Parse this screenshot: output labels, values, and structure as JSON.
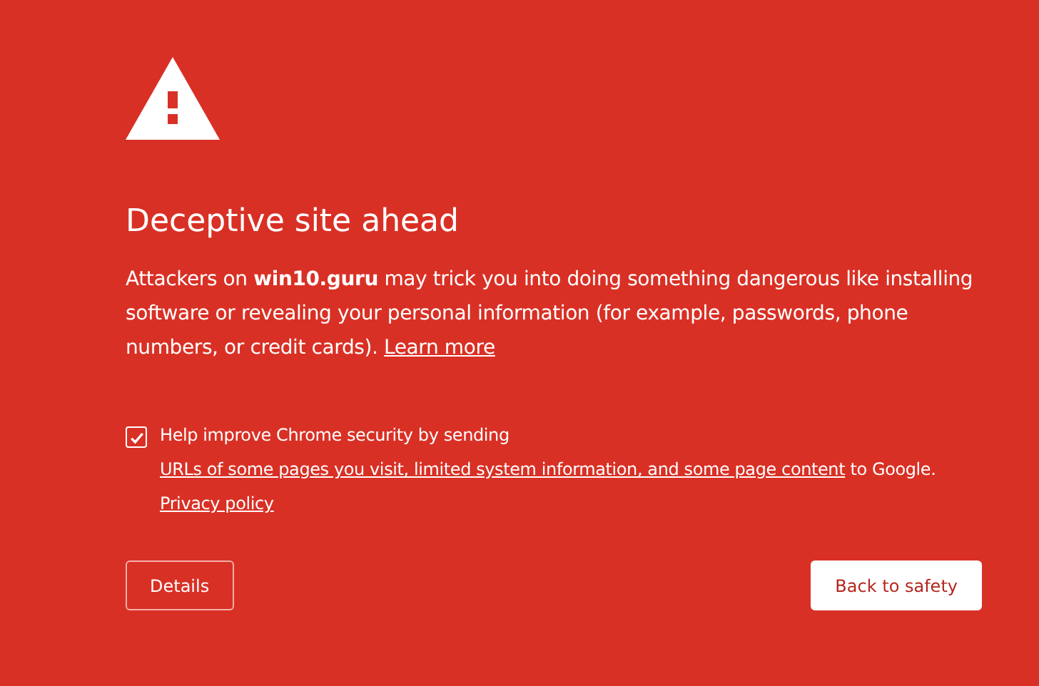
{
  "title": "Deceptive site ahead",
  "message": [
    {
      "kind": "text",
      "text": "Attackers on **win10.guru** may trick you into doing something dangerous like installing software or revealing your personal information (for example, passwords, phone numbers, or credit cards). "
    },
    {
      "kind": "link",
      "text": "Learn more"
    }
  ],
  "report": {
    "checked": true,
    "parts": [
      {
        "kind": "text",
        "text": "Help improve Chrome security by sending "
      },
      {
        "kind": "link",
        "text": "URLs of some pages you visit, limited system information, and some page content"
      },
      {
        "kind": "text",
        "text": " to Google. "
      },
      {
        "kind": "link",
        "text": "Privacy policy"
      }
    ]
  },
  "buttons": [
    {
      "kind": "outline",
      "label": "Details"
    },
    {
      "kind": "primary",
      "label": "Back to safety"
    }
  ]
}
